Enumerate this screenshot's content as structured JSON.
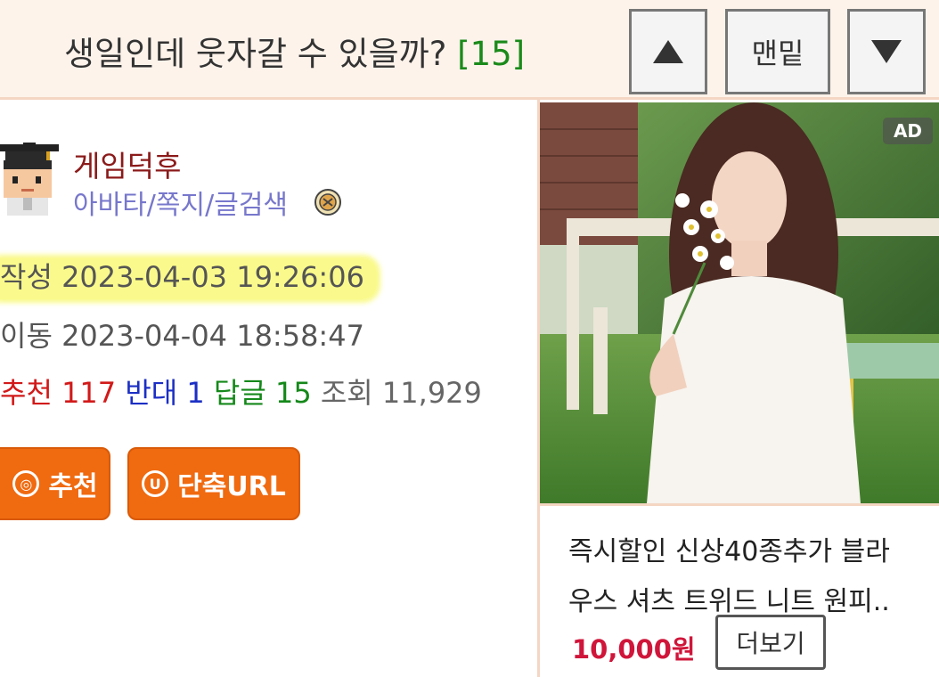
{
  "header": {
    "title": "생일인데 웃자갈 수 있을까?",
    "reply_count": "[15]",
    "up_icon": "triangle-up-icon",
    "bottom_label": "맨밑",
    "down_icon": "triangle-down-icon"
  },
  "author": {
    "name": "게임덕후",
    "links": "아바타/쪽지/글검색",
    "avatar_icon": "pixel-avatar-graduation-cap",
    "badge_icon": "seal-badge-icon"
  },
  "meta": {
    "created_label": "작성",
    "created_value": "2023-04-03 19:26:06",
    "moved_label": "이동",
    "moved_value": "2023-04-04 18:58:47",
    "recommend_label": "추천",
    "recommend_value": "117",
    "oppose_label": "반대",
    "oppose_value": "1",
    "reply_label": "답글",
    "reply_value": "15",
    "views_label": "조회",
    "views_value": "11,929"
  },
  "actions": {
    "recommend_icon_char": "◎",
    "recommend_label": "추천",
    "shorturl_icon_char": "U",
    "shorturl_label": "단축URL"
  },
  "ad": {
    "tag": "AD",
    "title_line1": "즉시할인 신상40종추가 블라",
    "title_line2": "우스 셔츠 트위드 니트 원피..",
    "price": "10,000원",
    "more_label": "더보기"
  },
  "colors": {
    "accent_orange": "#f06a10",
    "highlight_yellow": "#fafa8c",
    "header_bg": "#fdf3eb",
    "price_red": "#d0153a"
  }
}
